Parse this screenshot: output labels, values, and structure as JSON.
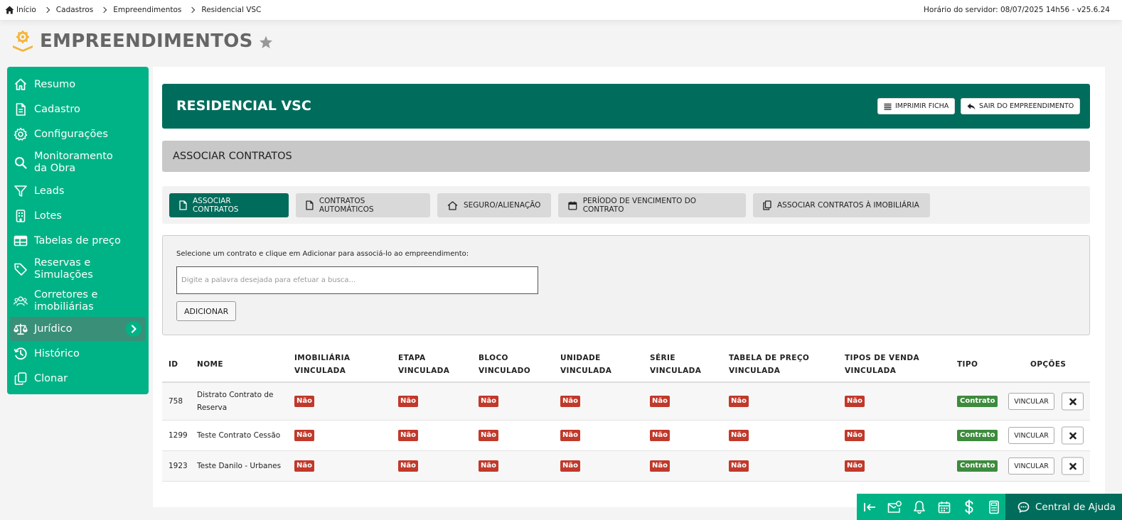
{
  "breadcrumb": {
    "items": [
      "Início",
      "Cadastros",
      "Empreendimentos",
      "Residencial VSC"
    ]
  },
  "server_info": "Horário do servidor: 08/07/2025 14h56 - v25.6.24",
  "page": {
    "title": "EMPREENDIMENTOS",
    "brand_color": "#f2b53a"
  },
  "sidebar": {
    "items": [
      {
        "label": "Resumo",
        "icon": "home-icon"
      },
      {
        "label": "Cadastro",
        "icon": "document-icon"
      },
      {
        "label": "Configurações",
        "icon": "gear-icon"
      },
      {
        "label": "Monitoramento da Obra",
        "line1": "Monitoramento",
        "line2": "da Obra",
        "icon": "search-icon"
      },
      {
        "label": "Leads",
        "icon": "filter-icon"
      },
      {
        "label": "Lotes",
        "icon": "building-icon"
      },
      {
        "label": "Tabelas de preço",
        "icon": "table-icon"
      },
      {
        "label": "Reservas e Simulações",
        "line1": "Reservas e",
        "line2": "Simulações",
        "icon": "tag-icon"
      },
      {
        "label": "Corretores e imobiliárias",
        "line1": "Corretores e",
        "line2": "imobiliárias",
        "icon": "users-icon"
      },
      {
        "label": "Jurídico",
        "icon": "scale-icon",
        "active": true
      },
      {
        "label": "Histórico",
        "icon": "history-icon"
      },
      {
        "label": "Clonar",
        "icon": "copy-icon"
      }
    ]
  },
  "header": {
    "title": "RESIDENCIAL VSC",
    "print_label": "IMPRIMIR FICHA",
    "exit_label": "SAIR DO EMPREENDIMENTO"
  },
  "section": {
    "title": "ASSOCIAR CONTRATOS"
  },
  "tabs": [
    {
      "label": "ASSOCIAR CONTRATOS",
      "active": true,
      "icon": "document-icon"
    },
    {
      "label": "CONTRATOS AUTOMÁTICOS",
      "active": false,
      "icon": "document-icon"
    },
    {
      "label": "SEGURO/ALIENAÇÃO",
      "active": false,
      "icon": "home-icon"
    },
    {
      "label": "PERÍODO DE VENCIMENTO DO CONTRATO",
      "active": false,
      "icon": "calendar-icon"
    },
    {
      "label": "ASSOCIAR CONTRATOS À IMOBILIÁRIA",
      "active": false,
      "icon": "copy-icon"
    }
  ],
  "search": {
    "hint": "Selecione um contrato e clique em Adicionar para associá-lo ao empreendimento:",
    "placeholder": "Digite a palavra desejada para efetuar a busca...",
    "value": "",
    "add_label": "ADICIONAR"
  },
  "table": {
    "headers": {
      "id": "ID",
      "nome": "NOME",
      "imobiliaria_1": "IMOBILIÁRIA",
      "imobiliaria_2": "VINCULADA",
      "etapa_1": "ETAPA",
      "etapa_2": "VINCULADA",
      "bloco_1": "BLOCO",
      "bloco_2": "VINCULADO",
      "unidade_1": "UNIDADE",
      "unidade_2": "VINCULADA",
      "serie_1": "SÉRIE",
      "serie_2": "VINCULADA",
      "tabela_1": "TABELA DE PREÇO",
      "tabela_2": "VINCULADA",
      "tipos_1": "TIPOS DE VENDA",
      "tipos_2": "VINCULADA",
      "tipo": "TIPO",
      "opcoes": "OPÇÕES"
    },
    "rows": [
      {
        "id": "758",
        "nome_1": "Distrato Contrato de",
        "nome_2": "Reserva",
        "imobiliaria": "Não",
        "etapa": "Não",
        "bloco": "Não",
        "unidade": "Não",
        "serie": "Não",
        "tabela": "Não",
        "tipos": "Não",
        "tipo": "Contrato",
        "vincular": "VINCULAR"
      },
      {
        "id": "1299",
        "nome_1": "Teste Contrato Cessão",
        "nome_2": "",
        "imobiliaria": "Não",
        "etapa": "Não",
        "bloco": "Não",
        "unidade": "Não",
        "serie": "Não",
        "tabela": "Não",
        "tipos": "Não",
        "tipo": "Contrato",
        "vincular": "VINCULAR"
      },
      {
        "id": "1923",
        "nome_1": "Teste Danilo - Urbanes",
        "nome_2": "",
        "imobiliaria": "Não",
        "etapa": "Não",
        "bloco": "Não",
        "unidade": "Não",
        "serie": "Não",
        "tabela": "Não",
        "tipos": "Não",
        "tipo": "Contrato",
        "vincular": "VINCULAR"
      }
    ]
  },
  "bottom_bar": {
    "icons": [
      "collapse-left-icon",
      "mail-alert-icon",
      "bell-icon",
      "calendar-icon",
      "dollar-icon",
      "calculator-icon"
    ],
    "help_label": "Central de Ajuda"
  },
  "colors": {
    "sidebar": "#00b386",
    "header": "#006c5b",
    "badge_no": "#c0392b",
    "badge_type": "#3d8b3d"
  }
}
